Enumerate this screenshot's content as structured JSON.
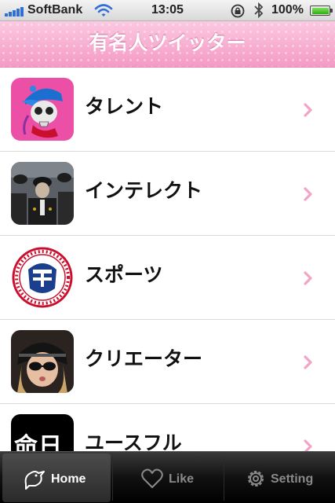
{
  "status_bar": {
    "carrier": "SoftBank",
    "time": "13:05",
    "battery": "100%",
    "battery_level": 1.0,
    "icons": [
      "signal-icon",
      "wifi-icon",
      "rotation-lock-icon",
      "bluetooth-icon",
      "battery-icon"
    ]
  },
  "nav": {
    "title": "有名人ツイッター"
  },
  "list": {
    "items": [
      {
        "label": "タレント",
        "thumb": "skull-cap-thumbnail"
      },
      {
        "label": "インテレクト",
        "thumb": "officers-photo-thumbnail"
      },
      {
        "label": "スポーツ",
        "thumb": "umpire-logo-thumbnail"
      },
      {
        "label": "クリエーター",
        "thumb": "sunglasses-portrait-thumbnail"
      },
      {
        "label": "ユースフル",
        "thumb": "kanji-calendar-thumbnail",
        "thumb_text": "命日"
      }
    ],
    "chevron_color": "#f4a3c7"
  },
  "tabs": [
    {
      "label": "Home",
      "icon": "bird-icon",
      "active": true
    },
    {
      "label": "Like",
      "icon": "heart-icon",
      "active": false
    },
    {
      "label": "Setting",
      "icon": "gear-icon",
      "active": false
    }
  ],
  "colors": {
    "nav_pink": "#f7a9cf",
    "chevron_pink": "#f4a3c7",
    "tab_bar": "#111111"
  }
}
